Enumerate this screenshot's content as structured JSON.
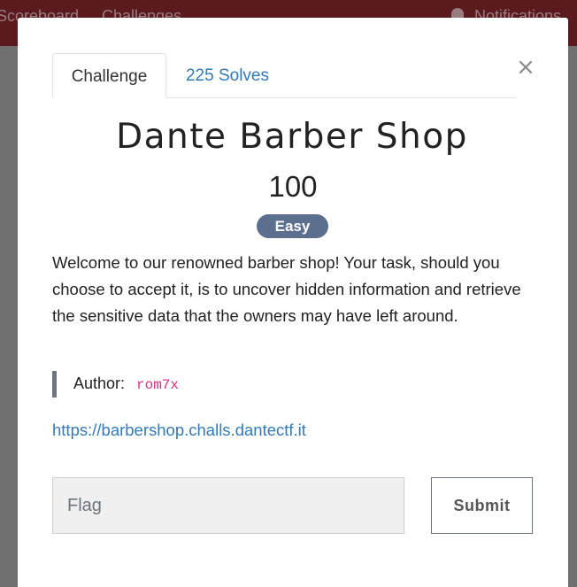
{
  "background": {
    "nav": {
      "scoreboard": "Scoreboard",
      "challenges": "Challenges",
      "notifications": "Notifications"
    }
  },
  "modal": {
    "close_symbol": "×",
    "tabs": [
      {
        "label": "Challenge",
        "active": true
      },
      {
        "label": "225 Solves",
        "active": false
      }
    ],
    "title": "Dante Barber Shop",
    "value": "100",
    "difficulty": "Easy",
    "description": "Welcome to our renowned barber shop! Your task, should you choose to accept it, is to uncover hidden information and retrieve the sensitive data that the owners may have left around.",
    "author_label": "Author:",
    "author_name": "rom7x",
    "link": "https://barbershop.challs.dantectf.it",
    "flag_placeholder": "Flag",
    "submit_label": "Submit"
  },
  "colors": {
    "navbar": "#5a1a1e",
    "link": "#337ab7",
    "badge": "#5c6f8f",
    "author_code": "#d63384"
  }
}
